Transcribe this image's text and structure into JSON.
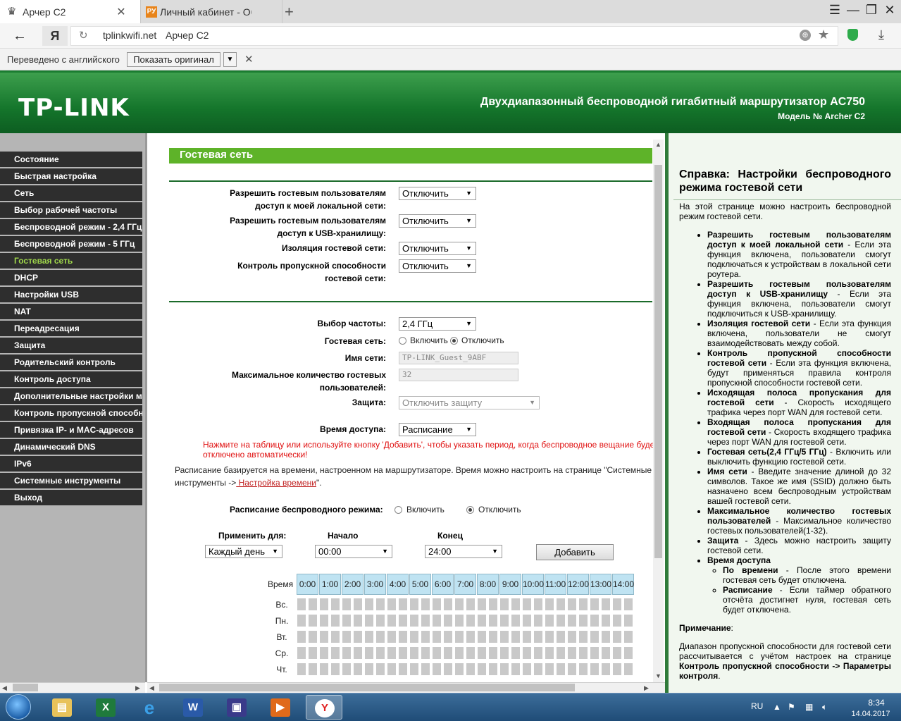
{
  "browser": {
    "tabs": [
      {
        "title": "Арчер C2",
        "active": true
      },
      {
        "title": "Личный кабинет - Обзоры",
        "active": false
      }
    ],
    "tab2_icon_text": "РУ",
    "yandex_button": "Я",
    "url_host": "tplinkwifi.net",
    "url_title": "Арчер C2",
    "translate_bar": {
      "label": "Переведено с английского",
      "show_original": "Показать оригинал"
    }
  },
  "header": {
    "logo": "TP-LINK",
    "title": "Двухдиапазонный беспроводной гигабитный маршрутизатор AC750",
    "model": "Модель № Archer C2"
  },
  "menu": {
    "items": [
      "Состояние",
      "Быстрая настройка",
      "Сеть",
      "Выбор рабочей частоты",
      "Беспроводной режим - 2,4 ГГц",
      "Беспроводной режим - 5 ГГц",
      "Гостевая сеть",
      "DHCP",
      "Настройки USB",
      "NAT",
      "Переадресация",
      "Защита",
      "Родительский контроль",
      "Контроль доступа",
      "Дополнительные настройки маршрутизации",
      "Контроль пропускной способности",
      "Привязка IP- и MAC-адресов",
      "Динамический DNS",
      "IPv6",
      "Системные инструменты",
      "Выход"
    ],
    "active_index": 6
  },
  "main": {
    "section_title": "Гостевая сеть",
    "f1_l1": "Разрешить гостевым пользователям",
    "f1_l2": "доступ к моей локальной сети:",
    "f1_value": "Отключить",
    "f2_l1": "Разрешить гостевым пользователям",
    "f2_l2": "доступ к USB-хранилищу:",
    "f2_value": "Отключить",
    "f3_l1": "Изоляция гостевой сети:",
    "f3_value": "Отключить",
    "f4_l1": "Контроль пропускной способности",
    "f4_l2": "гостевой сети:",
    "f4_value": "Отключить",
    "freq_label": "Выбор частоты:",
    "freq_value": "2,4 ГГц",
    "guest_label": "Гостевая сеть:",
    "enable": "Включить",
    "disable": "Отключить",
    "ssid_label": "Имя сети:",
    "ssid_value": "TP-LINK_Guest_9ABF",
    "max_l1": "Максимальное количество гостевых",
    "max_l2": "пользователей:",
    "max_value": "32",
    "security_label": "Защита:",
    "security_value": "Отключить защиту",
    "access_label": "Время доступа:",
    "access_value": "Расписание",
    "warn_line1": "Нажмите на таблицу или используйте кнопку 'Добавить', чтобы указать период, когда беспроводное вещание будет",
    "warn_line2": "отключено автоматически!",
    "info_line1": "Расписание базируется на времени, настроенном на маршрутизаторе. Время можно настроить на странице \"Системные",
    "info_line2_a": "инструменты ->",
    "info_link": " Настройка времени",
    "info_line2_b": "\".",
    "wsched_label": "Расписание беспроводного режима:",
    "apply_label": "Применить для:",
    "apply_value": "Каждый день",
    "start_label": "Начало",
    "start_value": "00:00",
    "end_label": "Конец",
    "end_value": "24:00",
    "add_button": "Добавить",
    "time_label": "Время",
    "hours": [
      "0:00",
      "1:00",
      "2:00",
      "3:00",
      "4:00",
      "5:00",
      "6:00",
      "7:00",
      "8:00",
      "9:00",
      "10:00",
      "11:00",
      "12:00",
      "13:00",
      "14:00"
    ],
    "days": [
      "Вс.",
      "Пн.",
      "Вт.",
      "Ср.",
      "Чт."
    ]
  },
  "help": {
    "title": "Справка: Настройки беспроводного режима гостевой сети",
    "intro": "На этой странице можно настроить беспроводной режим гостевой сети.",
    "items": [
      {
        "b": "Разрешить гостевым пользователям доступ к моей локальной сети",
        "t": " - Если эта функция включена, пользователи смогут подключаться к устройствам в локальной сети роутера."
      },
      {
        "b": "Разрешить гостевым пользователям доступ к USB-хранилищу",
        "t": " - Если эта функция включена, пользователи смогут подключиться к USB-хранилищу."
      },
      {
        "b": "Изоляция гостевой сети",
        "t": " - Если эта функция включена, пользователи не смогут взаимодействовать между собой."
      },
      {
        "b": "Контроль пропускной способности гостевой сети",
        "t": " - Если эта функция включена, будут применяться правила контроля пропускной способности гостевой сети."
      },
      {
        "b": "Исходящая полоса пропускания для гостевой сети",
        "t": " - Скорость исходящего трафика через порт WAN для гостевой сети."
      },
      {
        "b": "Входящая полоса пропускания для гостевой сети",
        "t": " - Скорость входящего трафика через порт WAN для гостевой сети."
      },
      {
        "b": "Гостевая сеть(2,4 ГГц/5 ГГц)",
        "t": " - Включить или выключить функцию гостевой сети."
      },
      {
        "b": "Имя сети",
        "t": " - Введите значение длиной до 32 символов. Такое же имя (SSID) должно быть назначено всем беспроводным устройствам вашей гостевой сети."
      },
      {
        "b": "Максимальное количество гостевых пользователей",
        "t": " - Максимальное количество гостевых пользователей(1-32)."
      },
      {
        "b": "Защита",
        "t": " - Здесь можно настроить защиту гостевой сети."
      },
      {
        "b": "Время доступа",
        "t": ""
      }
    ],
    "sub_items": [
      {
        "b": "По времени",
        "t": " - После этого времени гостевая сеть будет отключена."
      },
      {
        "b": "Расписание",
        "t": " - Если таймер обратного отсчёта достигнет нуля, гостевая сеть будет отключена."
      }
    ],
    "note_title": "Примечание",
    "note_colon": ":",
    "note_text": "Диапазон пропускной способности для гостевой сети рассчитывается с учётом настроек на странице ",
    "note_bold": "Контроль пропускной способности -> Параметры контроля",
    "note_end": "."
  },
  "taskbar": {
    "lang": "RU",
    "time": "8:34",
    "date": "14.04.2017",
    "apps": [
      "explorer-icon",
      "excel-icon",
      "ie-icon",
      "word-icon",
      "floppy-icon",
      "media-player-icon",
      "yandex-browser-icon"
    ]
  }
}
